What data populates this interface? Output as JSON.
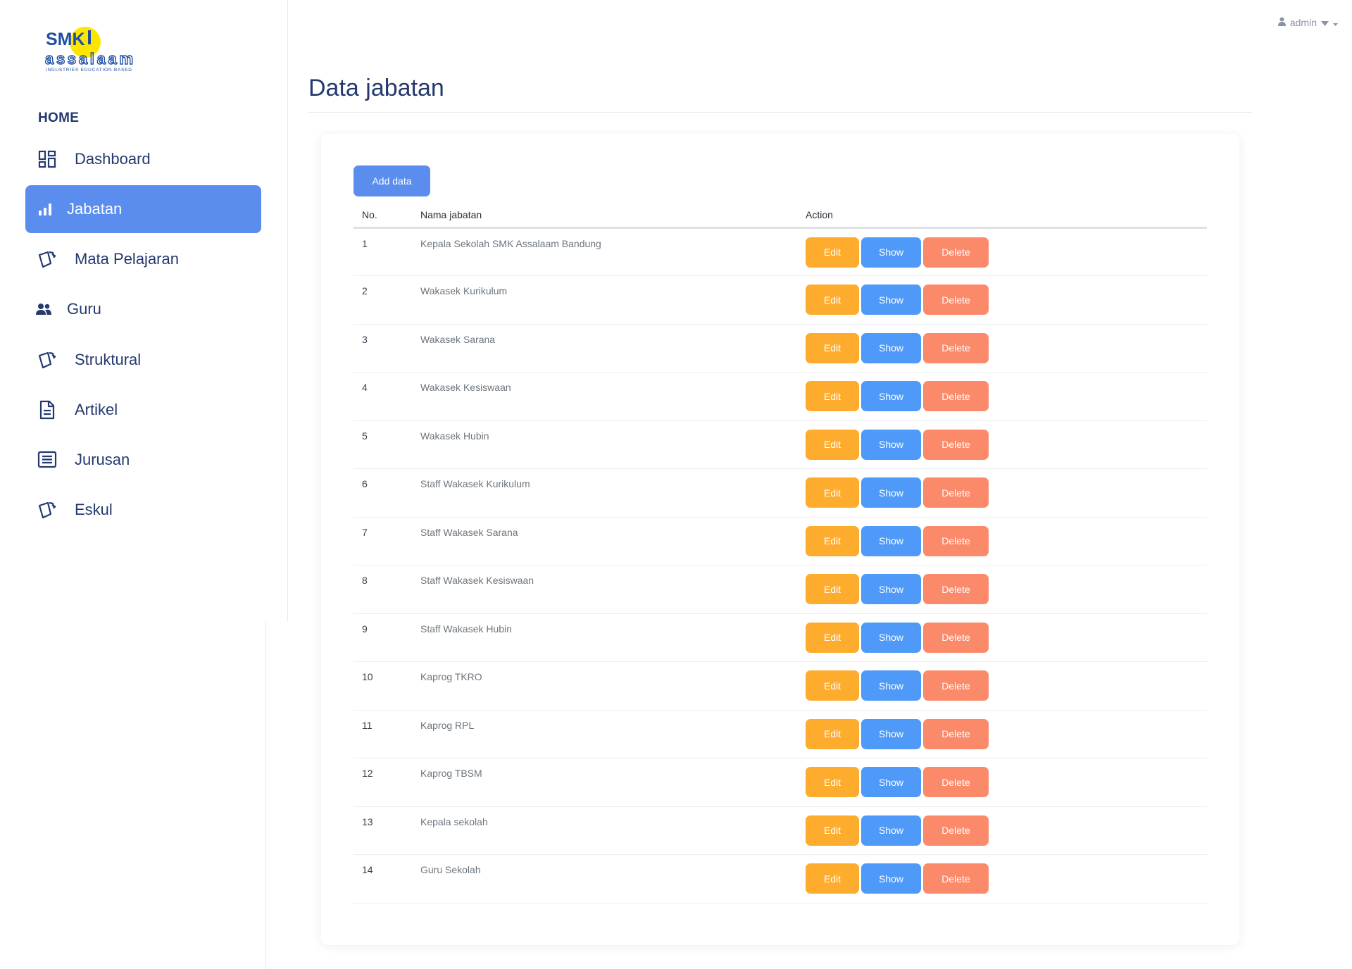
{
  "brand": {
    "logo_top": "SMK",
    "logo_bottom": "assalaam",
    "logo_tagline": "INDUSTRIES EDUCATION BASED"
  },
  "sidebar": {
    "section_label": "HOME",
    "items": [
      {
        "label": "Dashboard",
        "icon": "grid-icon",
        "active": false
      },
      {
        "label": "Jabatan",
        "icon": "bar-chart-icon",
        "active": true
      },
      {
        "label": "Mata Pelajaran",
        "icon": "cards-icon",
        "active": false
      },
      {
        "label": "Guru",
        "icon": "people-icon",
        "active": false
      },
      {
        "label": "Struktural",
        "icon": "cards-icon",
        "active": false
      },
      {
        "label": "Artikel",
        "icon": "file-icon",
        "active": false
      },
      {
        "label": "Jurusan",
        "icon": "list-icon",
        "active": false
      },
      {
        "label": "Eskul",
        "icon": "cards-icon",
        "active": false
      }
    ]
  },
  "user": {
    "name": "admin",
    "icon": "user-icon"
  },
  "page": {
    "title": "Data jabatan"
  },
  "toolbar": {
    "add_label": "Add data"
  },
  "table": {
    "headers": {
      "no": "No.",
      "name": "Nama jabatan",
      "action": "Action"
    },
    "action_labels": {
      "edit": "Edit",
      "show": "Show",
      "delete": "Delete"
    },
    "rows": [
      {
        "no": "1",
        "name": "Kepala Sekolah SMK Assalaam Bandung"
      },
      {
        "no": "2",
        "name": "Wakasek Kurikulum"
      },
      {
        "no": "3",
        "name": "Wakasek Sarana"
      },
      {
        "no": "4",
        "name": "Wakasek Kesiswaan"
      },
      {
        "no": "5",
        "name": "Wakasek Hubin"
      },
      {
        "no": "6",
        "name": "Staff Wakasek Kurikulum"
      },
      {
        "no": "7",
        "name": "Staff Wakasek Sarana"
      },
      {
        "no": "8",
        "name": "Staff Wakasek Kesiswaan"
      },
      {
        "no": "9",
        "name": "Staff Wakasek Hubin"
      },
      {
        "no": "10",
        "name": "Kaprog TKRO"
      },
      {
        "no": "11",
        "name": "Kaprog RPL"
      },
      {
        "no": "12",
        "name": "Kaprog TBSM"
      },
      {
        "no": "13",
        "name": "Kepala sekolah"
      },
      {
        "no": "14",
        "name": "Guru Sekolah"
      }
    ]
  },
  "colors": {
    "primary": "#5a8dee",
    "edit": "#fdac2d",
    "show": "#4f9af8",
    "delete": "#fb8a6b",
    "nav_text": "#25396f"
  }
}
